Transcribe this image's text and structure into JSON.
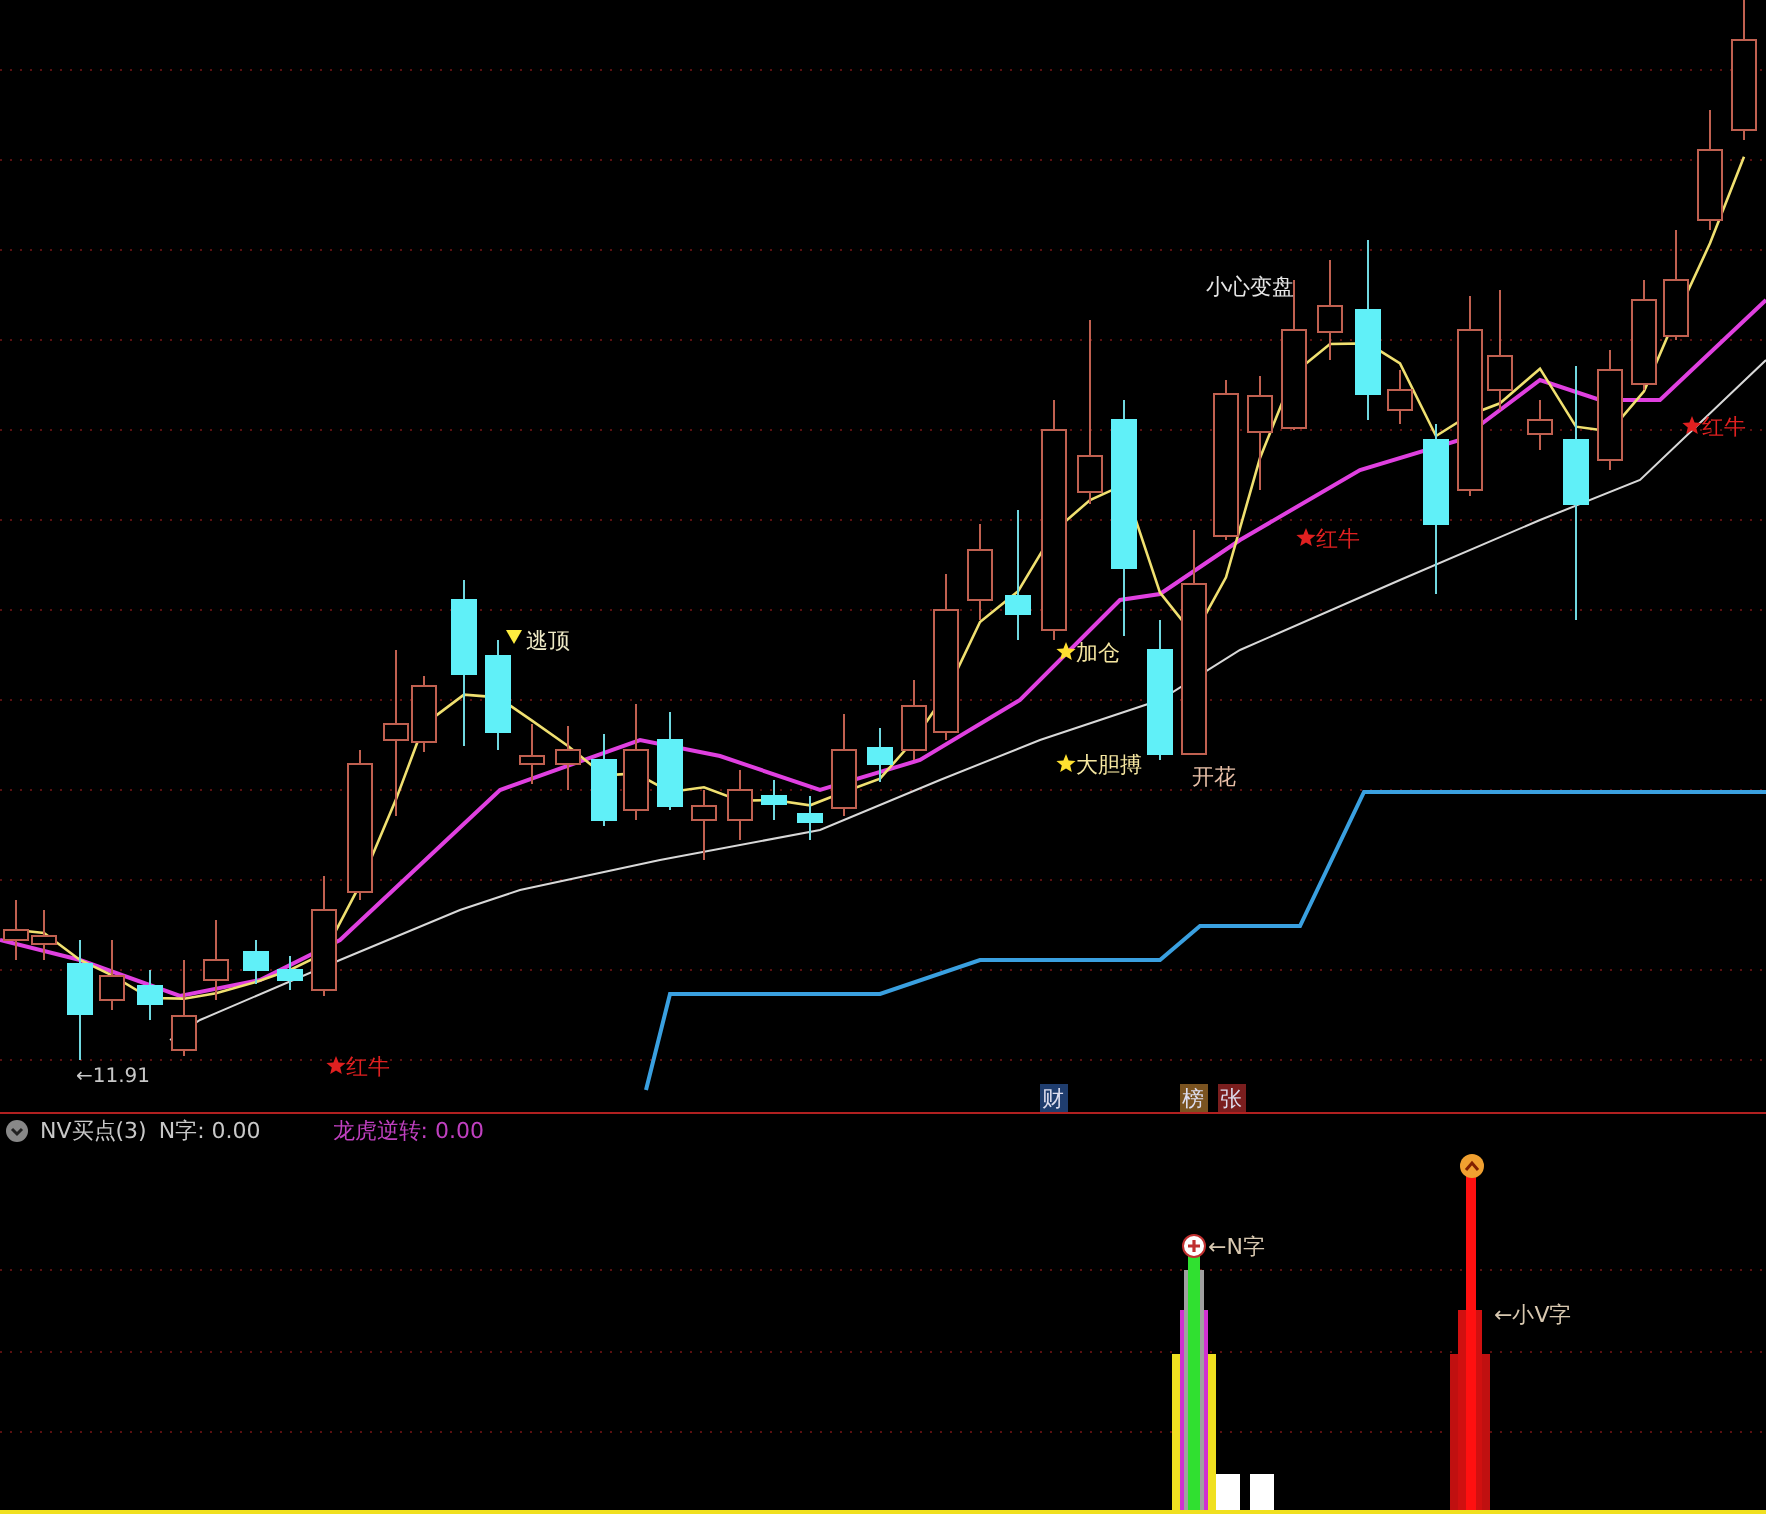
{
  "main_chart": {
    "signals": [
      {
        "text": "逃顶",
        "kind": "triangle",
        "color": "#f0ecc8"
      },
      {
        "text": "小心变盘",
        "kind": "plain",
        "color": "#e6e6e6"
      },
      {
        "text": "红牛",
        "kind": "star",
        "color": "#e02020"
      },
      {
        "text": "红牛",
        "kind": "star",
        "color": "#e02020"
      },
      {
        "text": "红牛",
        "kind": "star",
        "color": "#e02020"
      },
      {
        "text": "加仓",
        "kind": "star",
        "color": "#f5e6a0"
      },
      {
        "text": "大胆搏",
        "kind": "star",
        "color": "#f5e6a0"
      },
      {
        "text": "开花",
        "kind": "plain",
        "color": "#e8c0a8"
      }
    ],
    "price_marker": "←11.91",
    "event_badges": [
      {
        "text": "财",
        "color": "#1f3d6e"
      },
      {
        "text": "榜",
        "color": "#7a5320"
      },
      {
        "text": "张",
        "color": "#7a1e1e"
      }
    ]
  },
  "indicator": {
    "name": "NV买点(3)",
    "values": [
      {
        "text": "N字: 0.00",
        "color": "#c8c8c8"
      },
      {
        "text": "龙虎逆转: 0.00",
        "color": "#c040c0"
      }
    ],
    "annotations": [
      "←N字",
      "←小V字"
    ]
  }
}
